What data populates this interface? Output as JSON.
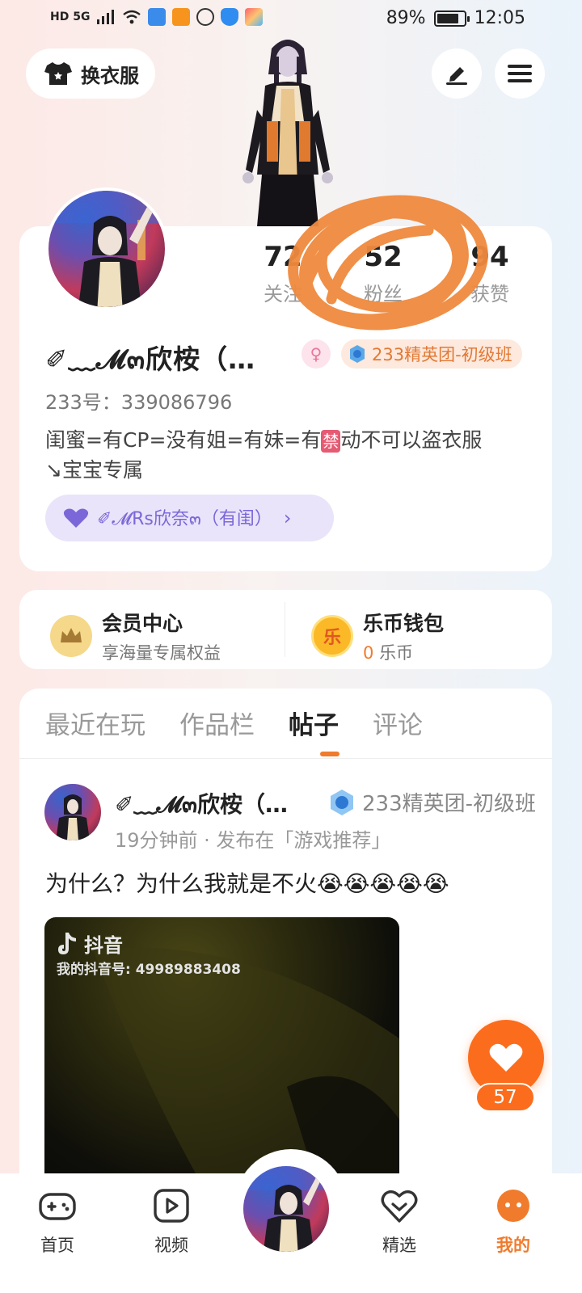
{
  "status": {
    "battery": "89%",
    "time": "12:05",
    "net": "HD 5G"
  },
  "top": {
    "outfit_label": "换衣服"
  },
  "profile": {
    "stats": [
      {
        "num": "72",
        "label": "关注"
      },
      {
        "num": "52",
        "label": "粉丝"
      },
      {
        "num": "94",
        "label": "获赞"
      }
    ],
    "nickname": "✐﹏𝓜๓欣桉（…",
    "gender": "♀",
    "rank": "233精英团-初级班",
    "uid": "233号：339086796",
    "bio_line1_a": "闺蜜=有CP=没有姐=有妹=有",
    "bio_ban": "禁",
    "bio_line1_b": "动不可以盗衣服",
    "bio_line2": "↘宝宝专属",
    "cp_label": "✐𝓜Rs欣奈๓（有闺）"
  },
  "member": {
    "title": "会员中心",
    "sub": "享海量专属权益",
    "icon": "crown-icon"
  },
  "wallet": {
    "title": "乐币钱包",
    "amount": "0",
    "unit": "乐币",
    "icon_text": "乐"
  },
  "tabs": [
    "最近在玩",
    "作品栏",
    "帖子",
    "评论"
  ],
  "post": {
    "author": "✐﹏𝓜๓欣桉（…",
    "rank": "233精英团-初级班",
    "meta": "19分钟前 · 发布在「游戏推荐」",
    "text": "为什么？为什么我就是不火😭😭😭😭😭",
    "watermark_app": "抖音",
    "watermark_id": "我的抖音号: 49989883408",
    "likes": "57"
  },
  "nav": {
    "home": "首页",
    "video": "视频",
    "featured": "精选",
    "mine": "我的"
  },
  "colors": {
    "accent": "#f07b2c",
    "like": "#fb6d1c",
    "cp": "#7b67d8"
  }
}
